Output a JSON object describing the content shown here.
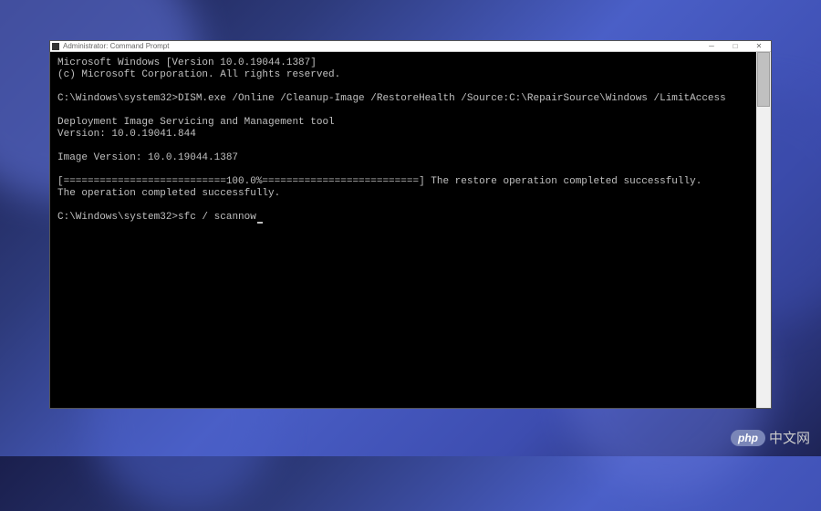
{
  "window": {
    "title": "Administrator: Command Prompt"
  },
  "terminal": {
    "lines": [
      "Microsoft Windows [Version 10.0.19044.1387]",
      "(c) Microsoft Corporation. All rights reserved.",
      "",
      "C:\\Windows\\system32>DISM.exe /Online /Cleanup-Image /RestoreHealth /Source:C:\\RepairSource\\Windows /LimitAccess",
      "",
      "Deployment Image Servicing and Management tool",
      "Version: 10.0.19041.844",
      "",
      "Image Version: 10.0.19044.1387",
      "",
      "[===========================100.0%==========================] The restore operation completed successfully.",
      "The operation completed successfully.",
      ""
    ],
    "prompt": "C:\\Windows\\system32>",
    "current_command": "sfc / scannow"
  },
  "watermark": {
    "badge": "php",
    "text": "中文网"
  }
}
